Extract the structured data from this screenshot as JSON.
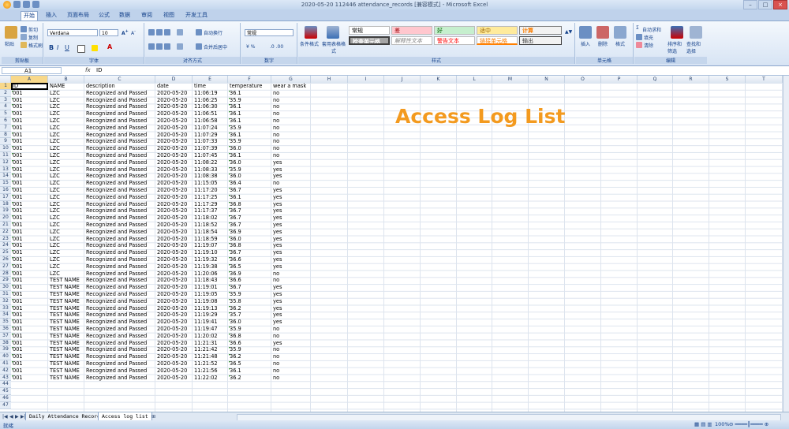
{
  "window": {
    "title": "2020-05-20 112446 attendance_records [兼容模式] - Microsoft Excel"
  },
  "tabs": [
    "开始",
    "插入",
    "页面布局",
    "公式",
    "数据",
    "审阅",
    "视图",
    "开发工具"
  ],
  "active_tab": "开始",
  "ribbon": {
    "clipboard": {
      "paste": "粘贴",
      "cut": "剪切",
      "copy": "复制",
      "format_painter": "格式刷",
      "label": "剪贴板"
    },
    "font": {
      "name": "Verdana",
      "size": "10",
      "label": "字体"
    },
    "alignment": {
      "wrap": "自动换行",
      "merge": "合并后居中",
      "label": "对齐方式"
    },
    "number": {
      "format": "常规",
      "label": "数字"
    },
    "styles": {
      "conditional": "条件格式",
      "table": "套用表格格式",
      "cell_styles": [
        "常规",
        "差",
        "好",
        "适中",
        "计算",
        "检查单元格",
        "解释性文本",
        "警告文本",
        "链接单元格",
        "输出"
      ],
      "label": "样式"
    },
    "cells": {
      "insert": "插入",
      "delete": "删除",
      "format": "格式",
      "label": "单元格"
    },
    "editing": {
      "autosum": "自动求和",
      "fill": "填充",
      "clear": "清除",
      "sort": "排序和筛选",
      "find": "查找和选择",
      "label": "编辑"
    }
  },
  "formula_bar": {
    "name_box": "A1",
    "fx": "fx",
    "content": "ID"
  },
  "columns": [
    "A",
    "B",
    "C",
    "D",
    "E",
    "F",
    "G",
    "H",
    "I",
    "J",
    "K",
    "L",
    "M",
    "N",
    "O",
    "P",
    "Q",
    "R",
    "S",
    "T"
  ],
  "headers": [
    "ID",
    "NAME",
    "description",
    "date",
    "time",
    "temperature",
    "wear a mask"
  ],
  "rows": [
    [
      "001",
      "LZC",
      "Recognized and Passed",
      "2020-05-20",
      "11:06:19",
      "36.1",
      "no"
    ],
    [
      "001",
      "LZC",
      "Recognized and Passed",
      "2020-05-20",
      "11:06:25",
      "35.9",
      "no"
    ],
    [
      "001",
      "LZC",
      "Recognized and Passed",
      "2020-05-20",
      "11:06:30",
      "36.1",
      "no"
    ],
    [
      "001",
      "LZC",
      "Recognized and Passed",
      "2020-05-20",
      "11:06:51",
      "36.1",
      "no"
    ],
    [
      "001",
      "LZC",
      "Recognized and Passed",
      "2020-05-20",
      "11:06:58",
      "36.1",
      "no"
    ],
    [
      "001",
      "LZC",
      "Recognized and Passed",
      "2020-05-20",
      "11:07:24",
      "35.9",
      "no"
    ],
    [
      "001",
      "LZC",
      "Recognized and Passed",
      "2020-05-20",
      "11:07:29",
      "36.1",
      "no"
    ],
    [
      "001",
      "LZC",
      "Recognized and Passed",
      "2020-05-20",
      "11:07:33",
      "35.9",
      "no"
    ],
    [
      "001",
      "LZC",
      "Recognized and Passed",
      "2020-05-20",
      "11:07:39",
      "36.0",
      "no"
    ],
    [
      "001",
      "LZC",
      "Recognized and Passed",
      "2020-05-20",
      "11:07:45",
      "36.1",
      "no"
    ],
    [
      "001",
      "LZC",
      "Recognized and Passed",
      "2020-05-20",
      "11:08:22",
      "36.0",
      "yes"
    ],
    [
      "001",
      "LZC",
      "Recognized and Passed",
      "2020-05-20",
      "11:08:33",
      "35.9",
      "yes"
    ],
    [
      "001",
      "LZC",
      "Recognized and Passed",
      "2020-05-20",
      "11:08:38",
      "36.0",
      "yes"
    ],
    [
      "001",
      "LZC",
      "Recognized and Passed",
      "2020-05-20",
      "11:15:05",
      "36.4",
      "no"
    ],
    [
      "001",
      "LZC",
      "Recognized and Passed",
      "2020-05-20",
      "11:17:20",
      "36.7",
      "yes"
    ],
    [
      "001",
      "LZC",
      "Recognized and Passed",
      "2020-05-20",
      "11:17:25",
      "36.1",
      "yes"
    ],
    [
      "001",
      "LZC",
      "Recognized and Passed",
      "2020-05-20",
      "11:17:29",
      "36.8",
      "yes"
    ],
    [
      "001",
      "LZC",
      "Recognized and Passed",
      "2020-05-20",
      "11:17:37",
      "36.7",
      "yes"
    ],
    [
      "001",
      "LZC",
      "Recognized and Passed",
      "2020-05-20",
      "11:18:02",
      "36.7",
      "yes"
    ],
    [
      "001",
      "LZC",
      "Recognized and Passed",
      "2020-05-20",
      "11:18:52",
      "36.7",
      "yes"
    ],
    [
      "001",
      "LZC",
      "Recognized and Passed",
      "2020-05-20",
      "11:18:54",
      "36.9",
      "yes"
    ],
    [
      "001",
      "LZC",
      "Recognized and Passed",
      "2020-05-20",
      "11:18:59",
      "36.0",
      "yes"
    ],
    [
      "001",
      "LZC",
      "Recognized and Passed",
      "2020-05-20",
      "11:19:07",
      "36.8",
      "yes"
    ],
    [
      "001",
      "LZC",
      "Recognized and Passed",
      "2020-05-20",
      "11:19:10",
      "36.7",
      "yes"
    ],
    [
      "001",
      "LZC",
      "Recognized and Passed",
      "2020-05-20",
      "11:19:32",
      "36.6",
      "yes"
    ],
    [
      "001",
      "LZC",
      "Recognized and Passed",
      "2020-05-20",
      "11:19:38",
      "36.5",
      "yes"
    ],
    [
      "001",
      "LZC",
      "Recognized and Passed",
      "2020-05-20",
      "11:20:06",
      "36.9",
      "no"
    ],
    [
      "001",
      "TEST NAME",
      "Recognized and Passed",
      "2020-05-20",
      "11:18:43",
      "36.6",
      "no"
    ],
    [
      "001",
      "TEST NAME",
      "Recognized and Passed",
      "2020-05-20",
      "11:19:01",
      "36.7",
      "yes"
    ],
    [
      "001",
      "TEST NAME",
      "Recognized and Passed",
      "2020-05-20",
      "11:19:05",
      "35.9",
      "yes"
    ],
    [
      "001",
      "TEST NAME",
      "Recognized and Passed",
      "2020-05-20",
      "11:19:08",
      "35.8",
      "yes"
    ],
    [
      "001",
      "TEST NAME",
      "Recognized and Passed",
      "2020-05-20",
      "11:19:13",
      "36.2",
      "yes"
    ],
    [
      "001",
      "TEST NAME",
      "Recognized and Passed",
      "2020-05-20",
      "11:19:29",
      "35.7",
      "yes"
    ],
    [
      "001",
      "TEST NAME",
      "Recognized and Passed",
      "2020-05-20",
      "11:19:41",
      "36.0",
      "yes"
    ],
    [
      "001",
      "TEST NAME",
      "Recognized and Passed",
      "2020-05-20",
      "11:19:47",
      "35.9",
      "no"
    ],
    [
      "001",
      "TEST NAME",
      "Recognized and Passed",
      "2020-05-20",
      "11:20:02",
      "36.8",
      "no"
    ],
    [
      "001",
      "TEST NAME",
      "Recognized and Passed",
      "2020-05-20",
      "11:21:31",
      "36.6",
      "yes"
    ],
    [
      "001",
      "TEST NAME",
      "Recognized and Passed",
      "2020-05-20",
      "11:21:42",
      "35.9",
      "no"
    ],
    [
      "001",
      "TEST NAME",
      "Recognized and Passed",
      "2020-05-20",
      "11:21:48",
      "36.2",
      "no"
    ],
    [
      "001",
      "TEST NAME",
      "Recognized and Passed",
      "2020-05-20",
      "11:21:52",
      "36.5",
      "no"
    ],
    [
      "001",
      "TEST NAME",
      "Recognized and Passed",
      "2020-05-20",
      "11:21:56",
      "36.1",
      "no"
    ],
    [
      "001",
      "TEST NAME",
      "Recognized and Passed",
      "2020-05-20",
      "11:22:02",
      "36.2",
      "no"
    ]
  ],
  "row_count": 47,
  "overlay_title": "Access Log List",
  "sheets": [
    "Daily Attendance Record",
    "Access log list"
  ],
  "active_sheet": "Access log list",
  "status": {
    "ready": "就绪",
    "zoom": "100%"
  },
  "colors": {
    "accent": "#f39a1f",
    "ribbon": "#dbe5f1"
  }
}
